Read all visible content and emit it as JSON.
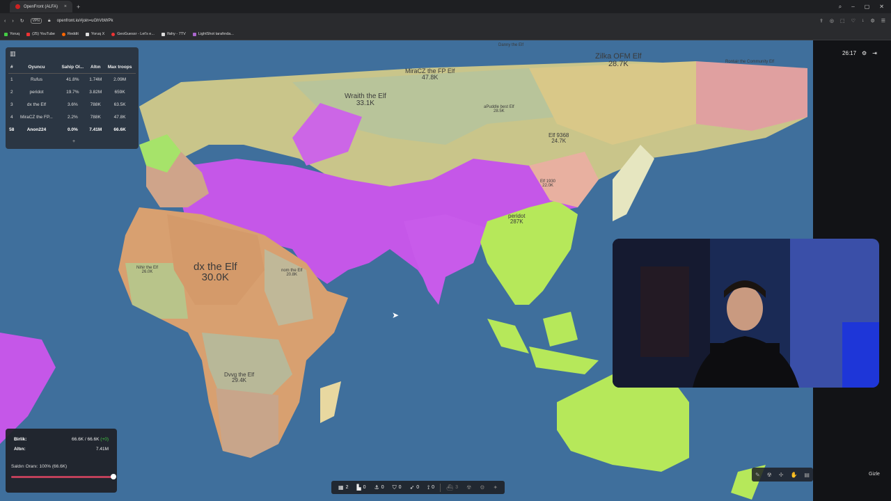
{
  "browser": {
    "tab_title": "OpenFront (ALFA)",
    "url": "openfront.io/#join=uGhVbWPk",
    "vpn": "VPN",
    "bookmarks": [
      "Yoruq",
      "(25) YouTube",
      "Reddit",
      "Yoruq X",
      "GeoGuessr - Let's e...",
      "Ifahy - 7TV",
      "LightShot tarafında..."
    ]
  },
  "game": {
    "timer": "26:17",
    "leaderboard": {
      "headers": [
        "#",
        "Oyuncu",
        "Sahip Ol...",
        "Altın",
        "Max troops"
      ],
      "rows": [
        {
          "rank": "1",
          "player": "Rufus",
          "owned": "41.8%",
          "gold": "1.74M",
          "troops": "2.09M"
        },
        {
          "rank": "2",
          "player": "peridot",
          "owned": "19.7%",
          "gold": "3.82M",
          "troops": "659K"
        },
        {
          "rank": "3",
          "player": "dx the Elf",
          "owned": "3.6%",
          "gold": "788K",
          "troops": "63.5K"
        },
        {
          "rank": "4",
          "player": "MiraCZ the FP...",
          "owned": "2.2%",
          "gold": "788K",
          "troops": "47.8K"
        },
        {
          "rank": "58",
          "player": "Anon224",
          "owned": "0.0%",
          "gold": "7.41M",
          "troops": "66.6K"
        }
      ],
      "expand": "+"
    },
    "stats": {
      "troops_label": "Birlik:",
      "troops_value": "66.6K / 66.6K",
      "troops_gain": "(+0)",
      "gold_label": "Altın:",
      "gold_value": "7.41M",
      "attack_rate": "Saldırı Oranı: 100% (66.6K)",
      "attack_ratio": 1.0
    },
    "toolbar": [
      {
        "icon": "city-icon",
        "count": "2"
      },
      {
        "icon": "factory-icon",
        "count": "0"
      },
      {
        "icon": "port-icon",
        "count": "0"
      },
      {
        "icon": "defense-icon",
        "count": "0"
      },
      {
        "icon": "missile-icon",
        "count": "0"
      },
      {
        "icon": "sam-icon",
        "count": "0"
      },
      {
        "icon": "warship-icon",
        "count": "3"
      }
    ],
    "hide_label": "Gizle",
    "map_labels": [
      {
        "name": "dx the Elf",
        "value": "30.0K"
      },
      {
        "name": "MiraCZ the FP Elf",
        "value": "47.8K"
      },
      {
        "name": "Zilka OFM Elf",
        "value": "28.7K"
      },
      {
        "name": "Wraith the Elf",
        "value": "33.1K"
      },
      {
        "name": "Elf 9368",
        "value": "24.7K"
      },
      {
        "name": "peridot",
        "value": "287K"
      },
      {
        "name": "Dvvg the Elf",
        "value": "29.4K"
      },
      {
        "name": "aPuddle best Elf",
        "value": "28.5K"
      },
      {
        "name": "Elf 1930",
        "value": "22.0K"
      },
      {
        "name": "Danny the Elf",
        "value": ""
      },
      {
        "name": "Rontair the Community Elf",
        "value": ""
      },
      {
        "name": "Nihir the Elf",
        "value": "26.0K"
      },
      {
        "name": "nom the Elf",
        "value": "20.8K"
      }
    ]
  }
}
